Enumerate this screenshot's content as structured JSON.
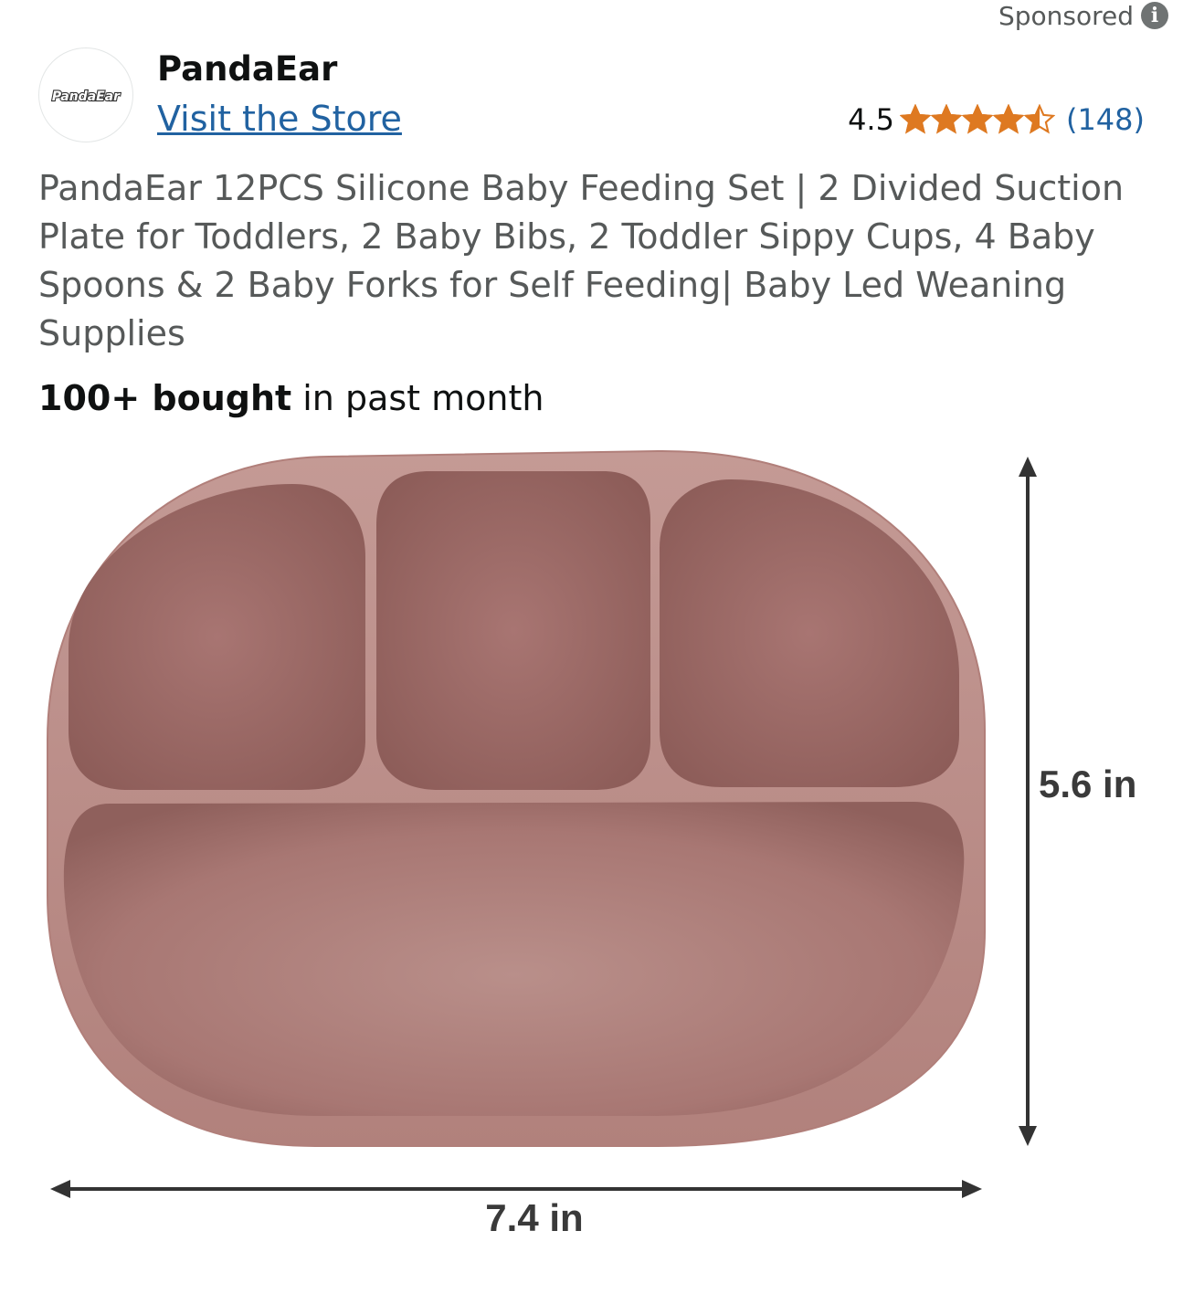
{
  "header": {
    "sponsored_label": "Sponsored",
    "info_icon": "info-icon"
  },
  "brand": {
    "logo_text": "PandaEar",
    "name": "PandaEar",
    "visit_store_label": "Visit the Store"
  },
  "rating": {
    "value": "4.5",
    "stars": 4.5,
    "count": "(148)",
    "star_color": "#de7921"
  },
  "product": {
    "title": "PandaEar 12PCS Silicone Baby Feeding Set | 2 Divided Suction Plate for Toddlers, 2 Baby Bibs, 2 Toddler Sippy Cups, 4 Baby Spoons & 2 Baby Forks for Self Feeding| Baby Led Weaning Supplies",
    "bought_bold": "100+ bought",
    "bought_rest": " in past month"
  },
  "image": {
    "description_icon": "divided-suction-plate-image",
    "plate_color": "#b58580",
    "height_label": "5.6 in",
    "width_label": "7.4 in"
  }
}
